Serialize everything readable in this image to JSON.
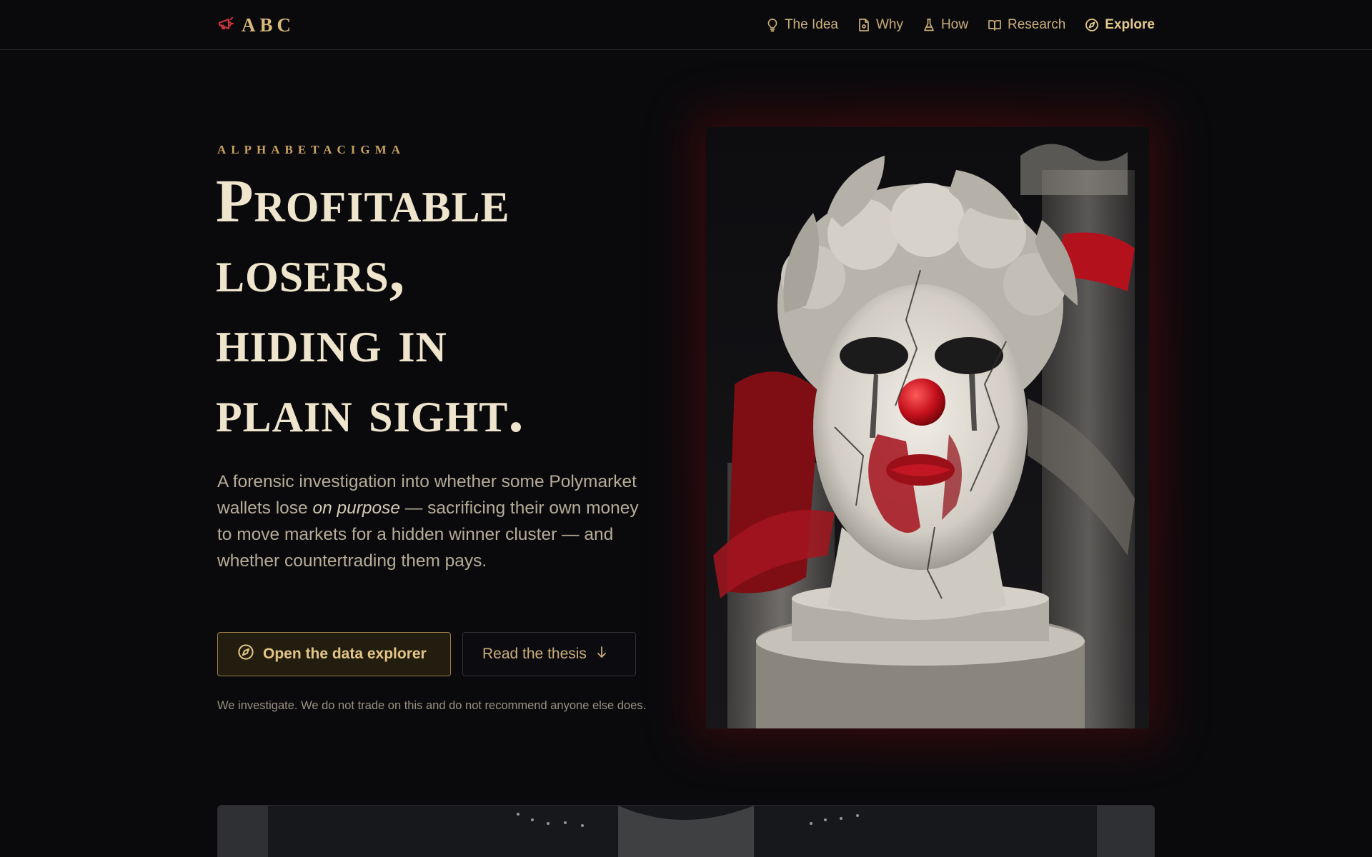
{
  "brand": {
    "name": "ABC",
    "logo_icon": "megaphone-icon",
    "accent_color": "#d8b97a",
    "logo_color": "#c8323a"
  },
  "nav": {
    "items": [
      {
        "label": "The Idea",
        "icon": "lightbulb-icon"
      },
      {
        "label": "Why",
        "icon": "document-icon"
      },
      {
        "label": "How",
        "icon": "flask-icon"
      },
      {
        "label": "Research",
        "icon": "book-icon"
      },
      {
        "label": "Explore",
        "icon": "compass-icon",
        "active": true
      }
    ]
  },
  "hero": {
    "eyebrow": "ALPHABETACIGMA",
    "headline_lines": [
      "Profitable",
      "losers,",
      "hiding in",
      "plain sight."
    ],
    "lede_before": "A forensic investigation into whether some Polymarket wallets lose ",
    "lede_emphasis": "on purpose",
    "lede_after": " — sacrificing their own money to move markets for a hidden winner cluster — and whether countertrading them pays.",
    "primary_button": "Open the data explorer",
    "secondary_button": "Read the thesis",
    "disclaimer": "We investigate. We do not trade on this and do not recommend anyone else does."
  },
  "artwork": {
    "subject": "cracked marble statue head with laurel wreath and red clown nose",
    "accent_red": "#b3121d"
  }
}
